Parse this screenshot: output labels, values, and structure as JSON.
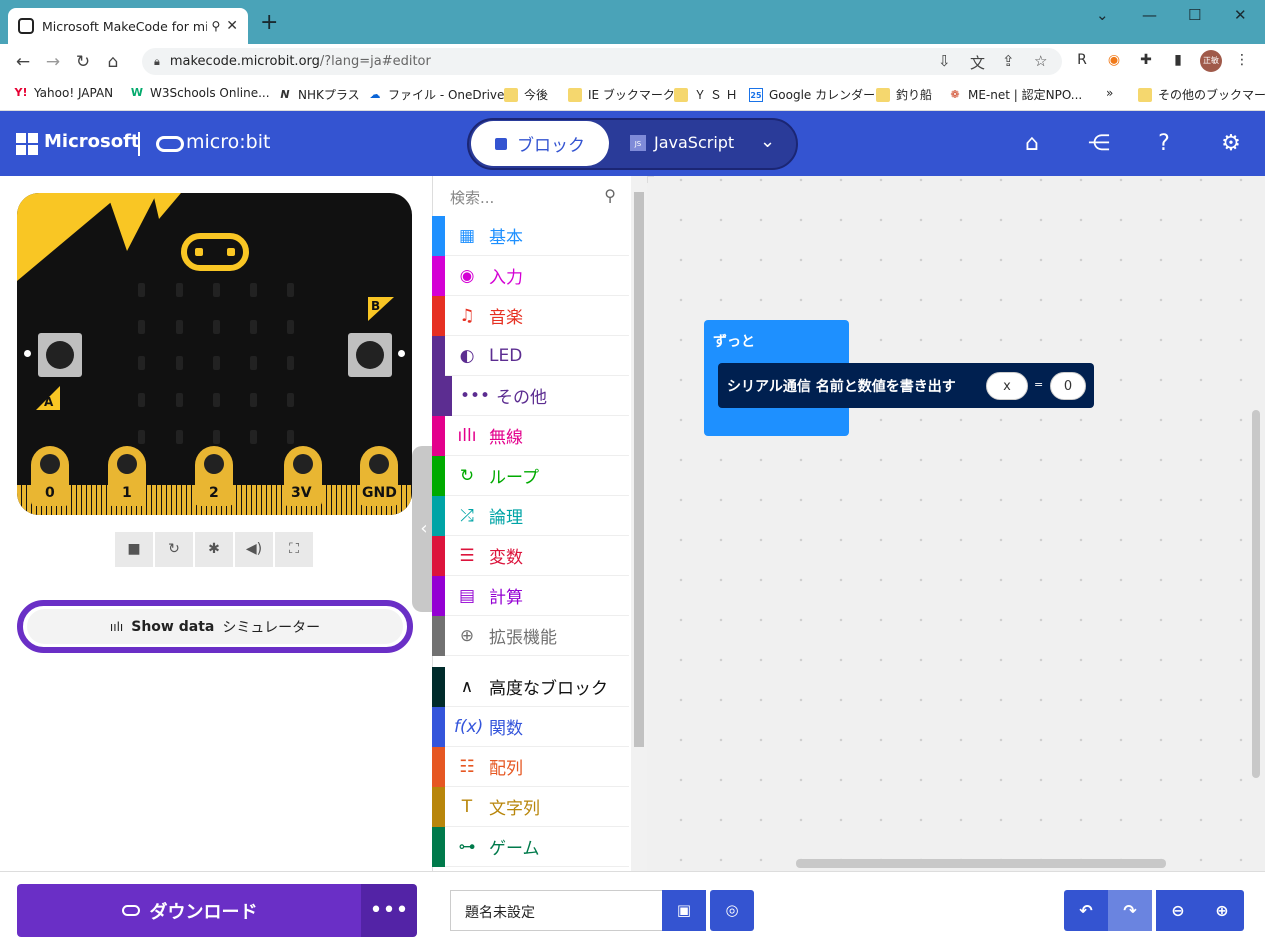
{
  "browser": {
    "tab_title": "Microsoft MakeCode for mic",
    "url_host": "makecode.microbit.org",
    "url_path": "/?lang=ja#editor",
    "avatar_text": "正敏"
  },
  "bookmarks": [
    {
      "label": "Yahoo! JAPAN",
      "icon": "Y!"
    },
    {
      "label": "W3Schools Online...",
      "icon": "W"
    },
    {
      "label": "NHKプラス",
      "icon": "N"
    },
    {
      "label": "ファイル - OneDrive",
      "icon": "cloud"
    },
    {
      "label": "今後",
      "icon": "folder"
    },
    {
      "label": "IE ブックマーク",
      "icon": "folder"
    },
    {
      "label": "Ｙ Ｓ Ｈ",
      "icon": "folder"
    },
    {
      "label": "Google カレンダー",
      "icon": "25"
    },
    {
      "label": "釣り船",
      "icon": "folder"
    },
    {
      "label": "ME-net | 認定NPO...",
      "icon": "globe"
    },
    {
      "label": "その他のブックマーク",
      "icon": "folder"
    }
  ],
  "header": {
    "brand": "Microsoft",
    "product": "micro:bit",
    "mode_blocks": "ブロック",
    "mode_js": "JavaScript"
  },
  "simulator": {
    "button_a": "A",
    "button_b": "B",
    "pins": [
      "0",
      "1",
      "2",
      "3V",
      "GND"
    ],
    "show_data_label": "Show data",
    "show_data_sub": "シミュレーター"
  },
  "toolbox": {
    "search_placeholder": "検索...",
    "categories": [
      {
        "label": "基本",
        "color": "#1e90ff"
      },
      {
        "label": "入力",
        "color": "#d400d4"
      },
      {
        "label": "音楽",
        "color": "#e63022"
      },
      {
        "label": "LED",
        "color": "#5c2d91"
      },
      {
        "label": "その他",
        "color": "#5c2d91"
      },
      {
        "label": "無線",
        "color": "#e3008c"
      },
      {
        "label": "ループ",
        "color": "#00aa00"
      },
      {
        "label": "論理",
        "color": "#00a4a6"
      },
      {
        "label": "変数",
        "color": "#dc143c"
      },
      {
        "label": "計算",
        "color": "#9400d3"
      },
      {
        "label": "拡張機能",
        "color": "#717171"
      },
      {
        "label": "高度なブロック",
        "color": "#002b2b"
      },
      {
        "label": "関数",
        "color": "#3455db"
      },
      {
        "label": "配列",
        "color": "#e65722"
      },
      {
        "label": "文字列",
        "color": "#b8860b"
      },
      {
        "label": "ゲーム",
        "color": "#007a4b"
      }
    ]
  },
  "workspace": {
    "forever_label": "ずっと",
    "serial_label": "シリアル通信 名前と数値を書き出す",
    "name_value": "x",
    "equals": "=",
    "number_value": "0"
  },
  "footer": {
    "download_label": "ダウンロード",
    "more": "•••",
    "project_name": "題名未設定"
  }
}
